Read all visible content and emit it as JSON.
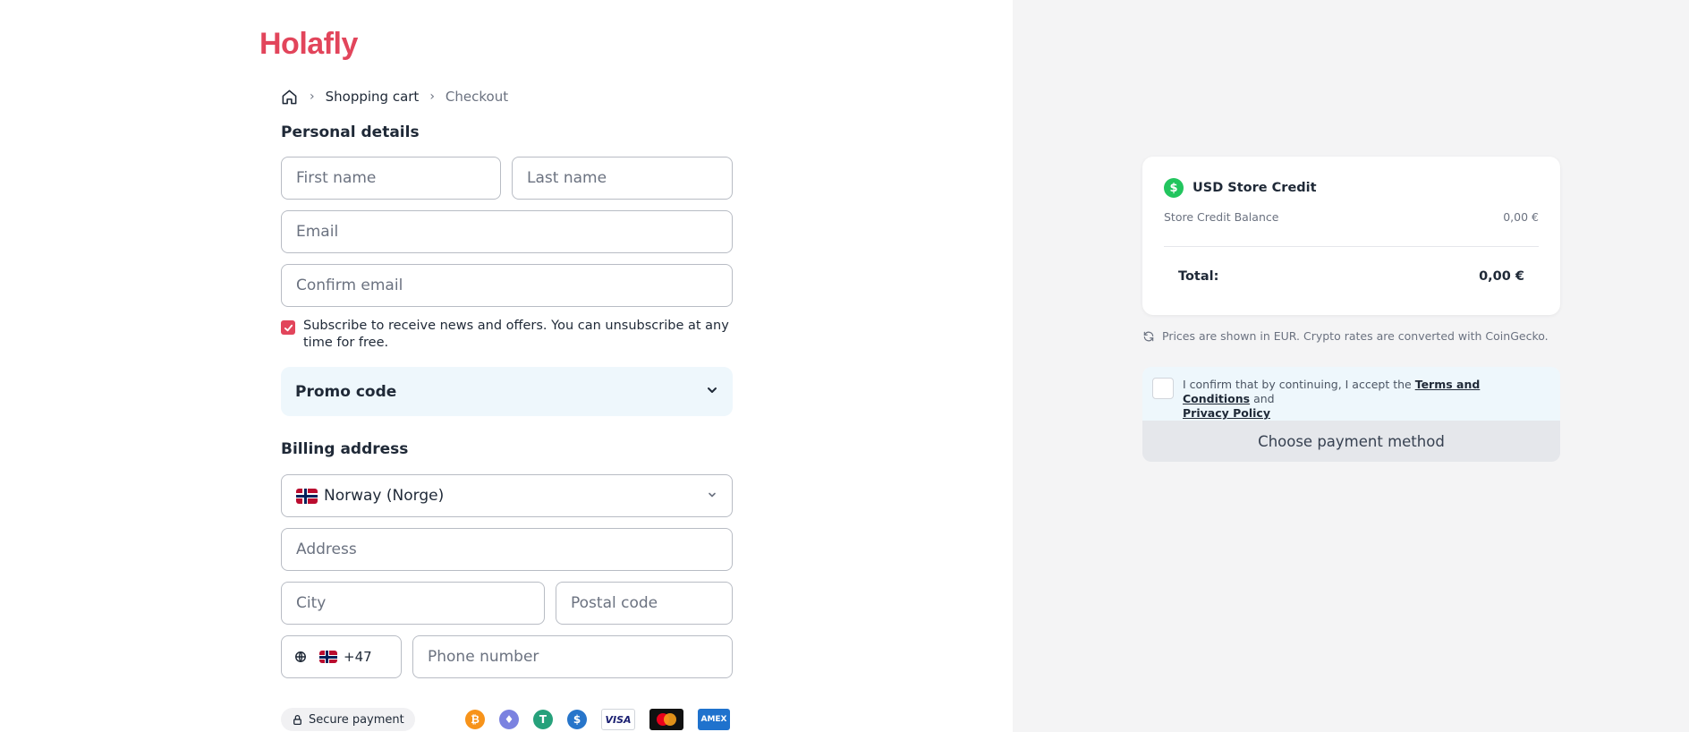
{
  "brand": {
    "logo_text": "Holafly",
    "accent": "#e2455b"
  },
  "breadcrumb": {
    "home_icon": "home-icon",
    "items": [
      "Shopping cart",
      "Checkout"
    ]
  },
  "personal": {
    "title": "Personal details",
    "first_name_placeholder": "First name",
    "last_name_placeholder": "Last name",
    "email_placeholder": "Email",
    "confirm_email_placeholder": "Confirm email",
    "subscribe_text": "Subscribe to receive news and offers. You can unsubscribe at any time for free.",
    "subscribe_checked": true
  },
  "promo": {
    "label": "Promo code"
  },
  "billing": {
    "title": "Billing address",
    "country": "Norway (Norge)",
    "address_placeholder": "Address",
    "city_placeholder": "City",
    "postal_placeholder": "Postal code",
    "phone_code": "+47",
    "phone_placeholder": "Phone number"
  },
  "footer": {
    "secure_label": "Secure payment",
    "payment_icons": [
      "bitcoin-icon",
      "ethereum-icon",
      "tether-icon",
      "usdc-icon",
      "visa-icon",
      "mastercard-icon",
      "amex-icon"
    ],
    "visa_label": "VISA",
    "amex_label": "AMEX"
  },
  "summary": {
    "credit_title": "USD Store Credit",
    "balance_label": "Store Credit Balance",
    "balance_value": "0,00 €",
    "total_label": "Total:",
    "total_value": "0,00 €"
  },
  "rates_note": "Prices are shown in EUR. Crypto rates are converted with CoinGecko.",
  "confirm": {
    "prefix": "I confirm that by continuing, I accept the ",
    "terms": "Terms and Conditions",
    "middle": " and",
    "privacy": "Privacy Policy"
  },
  "pay_button": "Choose payment method"
}
